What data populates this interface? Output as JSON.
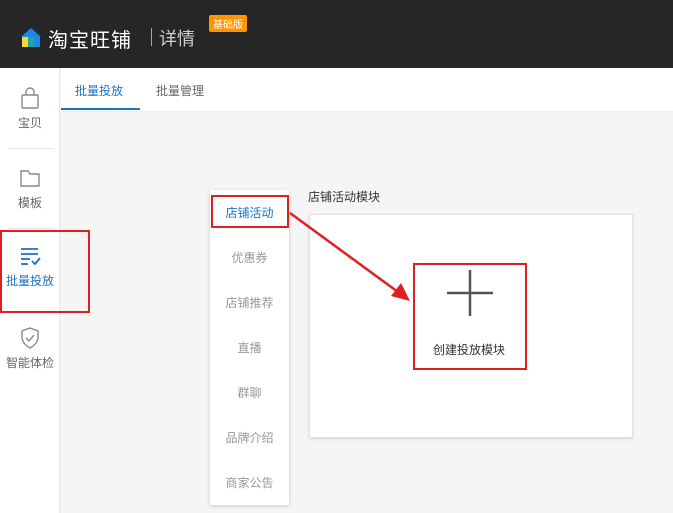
{
  "header": {
    "brand": "淘宝旺铺",
    "subtitle": "详情",
    "badge": "基础版"
  },
  "sidebar": {
    "items": [
      {
        "label": "宝贝",
        "icon": "bag-icon"
      },
      {
        "label": "模板",
        "icon": "folder-icon"
      },
      {
        "label": "批量投放",
        "icon": "list-check-icon"
      },
      {
        "label": "智能体检",
        "icon": "shield-check-icon"
      }
    ],
    "active_index": 2
  },
  "tabs": [
    {
      "label": "批量投放"
    },
    {
      "label": "批量管理"
    }
  ],
  "module_menu": {
    "items": [
      {
        "label": "店铺活动"
      },
      {
        "label": "优惠券"
      },
      {
        "label": "店铺推荐"
      },
      {
        "label": "直播"
      },
      {
        "label": "群聊"
      },
      {
        "label": "品牌介绍"
      },
      {
        "label": "商家公告"
      }
    ],
    "active_index": 0
  },
  "canvas": {
    "title": "店铺活动模块",
    "create_label": "创建投放模块"
  },
  "colors": {
    "accent": "#1a73c9",
    "highlight": "#e02020",
    "header_bg": "#262626",
    "badge_bg": "#ff9500"
  }
}
